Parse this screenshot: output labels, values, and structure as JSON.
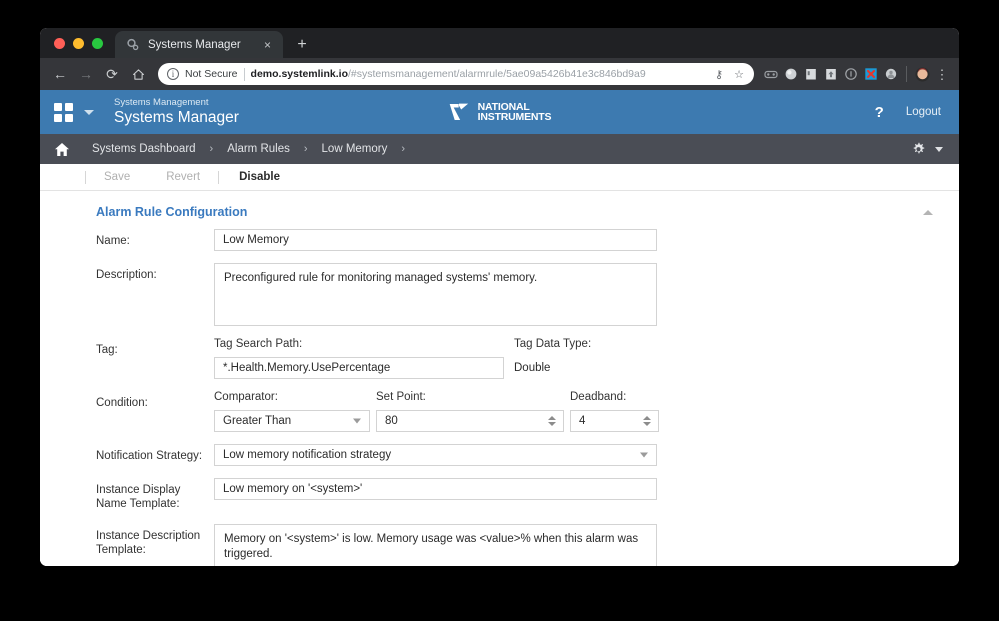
{
  "browser": {
    "tab": {
      "title": "Systems Manager",
      "favicon": "gear-favicon",
      "close": "×"
    },
    "new_tab": "+",
    "nav": {
      "back": "←",
      "forward": "→",
      "reload": "⟳",
      "home": "⌂"
    },
    "omnibox": {
      "info_glyph": "i",
      "security_label": "Not Secure",
      "url_domain": "demo.systemlink.io",
      "url_path": "/#systemsmanagement/alarmrule/5ae09a5426b41e3c846bd9a9",
      "key_icon": "⚷",
      "bookmark_icon": "☆"
    },
    "extensions": [
      "goggles-icon",
      "circle-icon",
      "note-icon",
      "upload-icon",
      "info-circle-icon",
      "x-blue-icon",
      "avatar-gray-icon"
    ],
    "profile_icon": "profile-avatar",
    "menu": "⋮"
  },
  "app_header": {
    "grid_icon": "apps-grid-icon",
    "caret": "chevron-down-icon",
    "subtitle": "Systems Management",
    "title": "Systems Manager",
    "logo": {
      "line1": "NATIONAL",
      "line2": "INSTRUMENTS"
    },
    "help": "?",
    "logout": "Logout",
    "color": "#3d7ab0"
  },
  "breadcrumb": {
    "home_icon": "home-icon",
    "items": [
      {
        "label": "Systems Dashboard",
        "arrow": "›"
      },
      {
        "label": "Alarm Rules",
        "arrow": "›"
      },
      {
        "label": "Low Memory",
        "arrow": "›"
      }
    ],
    "settings_icon": "gear-icon",
    "settings_caret": "chevron-down-icon",
    "color": "#4a4d55"
  },
  "toolbar": {
    "save": "Save",
    "revert": "Revert",
    "disable": "Disable"
  },
  "panel": {
    "title": "Alarm Rule Configuration",
    "collapse_icon": "chevron-up-icon",
    "title_color": "#3a7abf"
  },
  "form": {
    "name": {
      "label": "Name:",
      "value": "Low Memory"
    },
    "description": {
      "label": "Description:",
      "value": "Preconfigured rule for monitoring managed systems' memory."
    },
    "tag": {
      "label": "Tag:",
      "search_path_label": "Tag Search Path:",
      "search_path_value": "*.Health.Memory.UsePercentage",
      "data_type_label": "Tag Data Type:",
      "data_type_value": "Double"
    },
    "condition": {
      "label": "Condition:",
      "comparator_label": "Comparator:",
      "comparator_value": "Greater Than",
      "set_point_label": "Set Point:",
      "set_point_value": "80",
      "deadband_label": "Deadband:",
      "deadband_value": "4"
    },
    "notification_strategy": {
      "label": "Notification Strategy:",
      "value": "Low memory notification strategy"
    },
    "display_name_template": {
      "label": "Instance Display Name Template:",
      "value": "Low memory on '<system>'"
    },
    "description_template": {
      "label": "Instance Description Template:",
      "value": "Memory on '<system>' is low. Memory usage was <value>% when this alarm was triggered."
    }
  }
}
